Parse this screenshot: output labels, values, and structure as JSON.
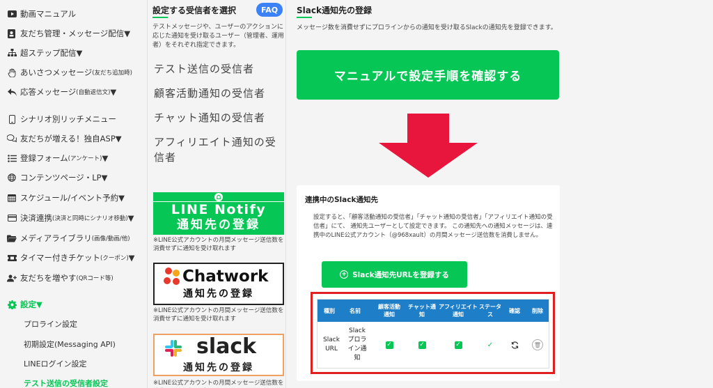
{
  "nav": {
    "items": [
      {
        "label": "動画マニュアル",
        "icon": "youtube-icon"
      },
      {
        "label": "友だち管理・メッセージ配信▼",
        "icon": "contacts-icon"
      },
      {
        "label": "超ステップ配信▼",
        "icon": "sitemap-icon"
      },
      {
        "label": "あいさつメッセージ",
        "small": "(友だち追加時)",
        "icon": "hand-icon"
      },
      {
        "label": "応答メッセージ",
        "small": "(自動返信文)",
        "suffix": "▼",
        "icon": "reply-icon"
      },
      {
        "label": "シナリオ別リッチメニュー",
        "icon": "mobile-icon"
      },
      {
        "label": "友だちが増える！独自ASP▼",
        "icon": "chat-icon"
      },
      {
        "label": "登録フォーム",
        "small": "(アンケート)",
        "suffix": "▼",
        "icon": "list-icon"
      },
      {
        "label": "コンテンツページ・LP▼",
        "icon": "globe-icon"
      },
      {
        "label": "スケジュール/イベント予約▼",
        "icon": "calendar-icon"
      },
      {
        "label": "決済連携",
        "small": "(決済と同時にシナリオ移動)",
        "suffix": "▼",
        "icon": "card-icon"
      },
      {
        "label": "メディアライブラリ",
        "small": "(画像/動画/他)",
        "icon": "folder-icon"
      },
      {
        "label": "タイマー付きチケット",
        "small": "(クーポン)",
        "suffix": "▼",
        "icon": "ticket-icon"
      },
      {
        "label": "友だちを増やす",
        "small": "(QRコード等)",
        "icon": "user-plus-icon"
      }
    ],
    "settings": {
      "label": "設定▼",
      "icon": "gear-icon"
    },
    "subs": [
      {
        "label": "プロライン設定"
      },
      {
        "label": "初期設定(Messaging API)"
      },
      {
        "label": "LINEログイン設定"
      },
      {
        "label": "テスト送信の受信者設定"
      }
    ]
  },
  "mid": {
    "title": "設定する受信者を選択",
    "faq": "FAQ",
    "desc": "テストメッセージや、ユーザーのアクションに応じた通知を受け取るユーザー（管理者、運用者）をそれぞれ指定できます。",
    "receivers": [
      "テスト送信の受信者",
      "顧客活動通知の受信者",
      "チャット通知の受信者",
      "アフィリエイト通知の受信者"
    ],
    "banners": {
      "line_notify": {
        "line1": "LINE Notify",
        "line2": "通知先の登録",
        "color": "#06c755"
      },
      "chatwork": {
        "line1": "Chatwork",
        "line2": "通知先の登録"
      },
      "slack": {
        "line1": "slack",
        "line2": "通知先の登録",
        "border": "#f0a060"
      }
    },
    "note": "※LINE公式アカウントの月間メッセージ送信数を消費せずに通知を受け取れます"
  },
  "right": {
    "title": "Slack通知先の登録",
    "desc": "メッセージ数を消費せずにプロラインからの通知を受け取るSlackの通知先を登録できます。",
    "manual_button": "マニュアルで設定手順を確認する",
    "arrow_color": "#e8163c",
    "card": {
      "title": "連携中のSlack通知先",
      "desc": "設定すると、「顧客活動通知の受信者」「チャット通知の受信者」「アフィリエイト通知の受信者」にて、 通知先ユーザーとして設定できます。 この通知先への通知メッセージは、連携中のLINE公式アカウント（@968xault）の月間メッセージ送信数を消費しません。",
      "register_button": "Slack通知先URLを登録する",
      "table": {
        "headers": [
          "種別",
          "名前",
          "顧客活動通知",
          "チャット通知",
          "アフィリエイト通知",
          "ステータス",
          "確認",
          "削除"
        ],
        "row": {
          "type": "Slack URL",
          "name": "Slack プロライン通知"
        }
      }
    }
  }
}
